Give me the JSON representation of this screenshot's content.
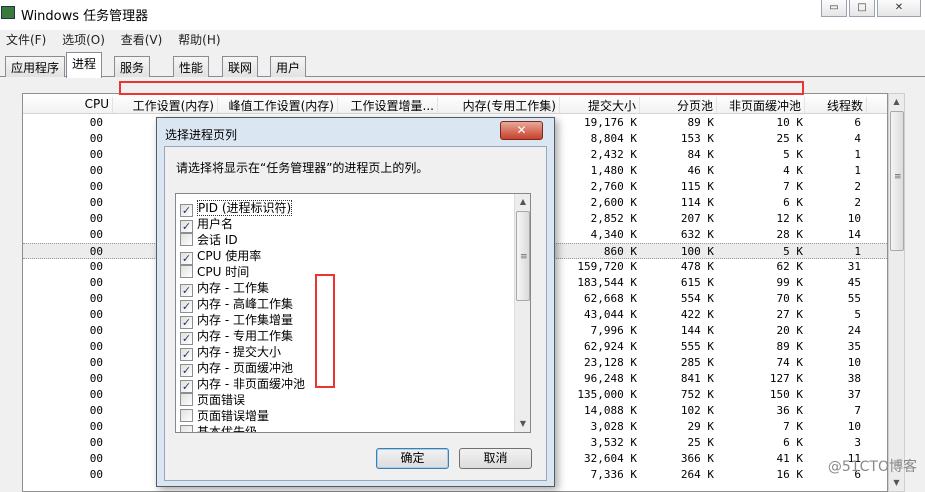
{
  "window": {
    "title": "Windows 任务管理器",
    "minimize_glyph": "▭",
    "maximize_glyph": "□",
    "close_glyph": "✕"
  },
  "menu": [
    "文件(F)",
    "选项(O)",
    "查看(V)",
    "帮助(H)"
  ],
  "tabs": [
    "应用程序",
    "进程",
    "服务",
    "性能",
    "联网",
    "用户"
  ],
  "columns": [
    "CPU",
    "工作设置(内存)",
    "峰值工作设置(内存)",
    "工作设置增量...",
    "内存(专用工作集)",
    "提交大小",
    "分页池",
    "非页面缓冲池",
    "线程数"
  ],
  "rows": [
    {
      "cpu": "00",
      "commit": "19,176 K",
      "paged": "89 K",
      "nonpaged": "10 K",
      "threads": "6"
    },
    {
      "cpu": "00",
      "commit": "8,804 K",
      "paged": "153 K",
      "nonpaged": "25 K",
      "threads": "4"
    },
    {
      "cpu": "00",
      "commit": "2,432 K",
      "paged": "84 K",
      "nonpaged": "5 K",
      "threads": "1"
    },
    {
      "cpu": "00",
      "commit": "1,480 K",
      "paged": "46 K",
      "nonpaged": "4 K",
      "threads": "1"
    },
    {
      "cpu": "00",
      "commit": "2,760 K",
      "paged": "115 K",
      "nonpaged": "7 K",
      "threads": "2"
    },
    {
      "cpu": "00",
      "commit": "2,600 K",
      "paged": "114 K",
      "nonpaged": "6 K",
      "threads": "2"
    },
    {
      "cpu": "00",
      "commit": "2,852 K",
      "paged": "207 K",
      "nonpaged": "12 K",
      "threads": "10"
    },
    {
      "cpu": "00",
      "commit": "4,340 K",
      "paged": "632 K",
      "nonpaged": "28 K",
      "threads": "14"
    },
    {
      "cpu": "00",
      "commit": "860 K",
      "paged": "100 K",
      "nonpaged": "5 K",
      "threads": "1"
    },
    {
      "cpu": "00",
      "commit": "159,720 K",
      "paged": "478 K",
      "nonpaged": "62 K",
      "threads": "31"
    },
    {
      "cpu": "00",
      "commit": "183,544 K",
      "paged": "615 K",
      "nonpaged": "99 K",
      "threads": "45"
    },
    {
      "cpu": "00",
      "commit": "62,668 K",
      "paged": "554 K",
      "nonpaged": "70 K",
      "threads": "55"
    },
    {
      "cpu": "00",
      "commit": "43,044 K",
      "paged": "422 K",
      "nonpaged": "27 K",
      "threads": "5"
    },
    {
      "cpu": "00",
      "commit": "7,996 K",
      "paged": "144 K",
      "nonpaged": "20 K",
      "threads": "24"
    },
    {
      "cpu": "00",
      "commit": "62,924 K",
      "paged": "555 K",
      "nonpaged": "89 K",
      "threads": "35"
    },
    {
      "cpu": "00",
      "commit": "23,128 K",
      "paged": "285 K",
      "nonpaged": "74 K",
      "threads": "10"
    },
    {
      "cpu": "00",
      "commit": "96,248 K",
      "paged": "841 K",
      "nonpaged": "127 K",
      "threads": "38"
    },
    {
      "cpu": "00",
      "commit": "135,000 K",
      "paged": "752 K",
      "nonpaged": "150 K",
      "threads": "37"
    },
    {
      "cpu": "00",
      "commit": "14,088 K",
      "paged": "102 K",
      "nonpaged": "36 K",
      "threads": "7"
    },
    {
      "cpu": "00",
      "commit": "3,028 K",
      "paged": "29 K",
      "nonpaged": "7 K",
      "threads": "10"
    },
    {
      "cpu": "00",
      "commit": "3,532 K",
      "paged": "25 K",
      "nonpaged": "6 K",
      "threads": "3"
    },
    {
      "cpu": "00",
      "commit": "32,604 K",
      "paged": "366 K",
      "nonpaged": "41 K",
      "threads": "11"
    },
    {
      "cpu": "00",
      "commit": "7,336 K",
      "paged": "264 K",
      "nonpaged": "16 K",
      "threads": "6"
    }
  ],
  "dialog": {
    "title": "选择进程页列",
    "close_glyph": "✕",
    "message": "请选择将显示在“任务管理器”的进程页上的列。",
    "items": [
      {
        "label": "PID (进程标识符)",
        "checked": true
      },
      {
        "label": "用户名",
        "checked": true
      },
      {
        "label": "会话 ID",
        "checked": false
      },
      {
        "label": "CPU 使用率",
        "checked": true
      },
      {
        "label": "CPU 时间",
        "checked": false
      },
      {
        "label": "内存 - 工作集",
        "checked": true
      },
      {
        "label": "内存 - 高峰工作集",
        "checked": true
      },
      {
        "label": "内存 - 工作集增量",
        "checked": true
      },
      {
        "label": "内存 - 专用工作集",
        "checked": true
      },
      {
        "label": "内存 - 提交大小",
        "checked": true
      },
      {
        "label": "内存 - 页面缓冲池",
        "checked": true
      },
      {
        "label": "内存 - 非页面缓冲池",
        "checked": true
      },
      {
        "label": "页面错误",
        "checked": false
      },
      {
        "label": "页面错误增量",
        "checked": false
      },
      {
        "label": "基本优先级",
        "checked": false
      }
    ],
    "ok_label": "确定",
    "cancel_label": "取消"
  },
  "watermark": "@51CTO博客"
}
